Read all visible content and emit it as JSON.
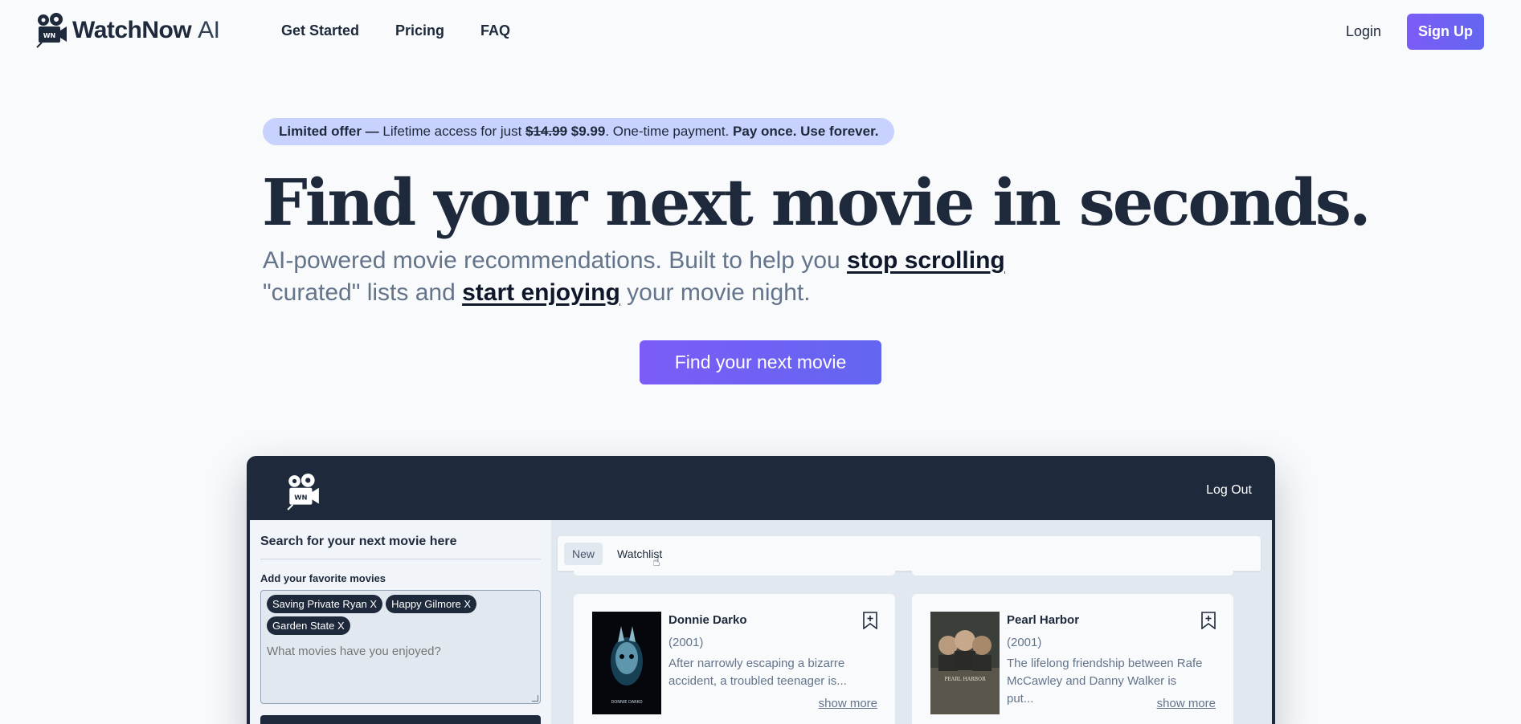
{
  "nav": {
    "brand_name": "WatchNow",
    "brand_suffix": "AI",
    "logo_badge": "WN",
    "links": [
      "Get Started",
      "Pricing",
      "FAQ"
    ],
    "login": "Login",
    "signup": "Sign Up"
  },
  "offer": {
    "lead": "Limited offer",
    "dash": " — ",
    "text": "Lifetime access for just ",
    "old_price": "$14.99",
    "new_price": "$9.99",
    "after": ". One-time payment. ",
    "tail": "Pay once. Use forever."
  },
  "hero": {
    "headline": "Find your next movie in seconds.",
    "sub_1": "AI-powered movie recommendations. Built to help you ",
    "sub_link_1": "stop scrolling",
    "sub_2": "\"curated\" lists and ",
    "sub_link_2": "start enjoying",
    "sub_3": " your movie night.",
    "cta": "Find your next movie"
  },
  "app": {
    "logo_badge": "WN",
    "logout": "Log Out",
    "search_title": "Search for your next movie here",
    "fav_label": "Add your favorite movies",
    "chips": [
      "Saving Private Ryan X",
      "Happy Gilmore X",
      "Garden State X"
    ],
    "fav_placeholder": "What movies have you enjoyed?",
    "tabs": [
      "New",
      "Watchlist"
    ],
    "movies": [
      {
        "title": "Donnie Darko",
        "year": "(2001)",
        "desc": "After narrowly escaping a bizarre accident, a troubled teenager is...",
        "more": "show more",
        "poster_text": "DONNIE DARKO"
      },
      {
        "title": "Pearl Harbor",
        "year": "(2001)",
        "desc": "The lifelong friendship between Rafe McCawley and Danny Walker is put...",
        "more": "show more",
        "poster_text": "PEARL HARBOR"
      }
    ]
  },
  "colors": {
    "accent": "#6366f1",
    "accent_start": "#7c5cf6",
    "dark": "#1e293b",
    "offer_bg": "#c7d2fe",
    "page_bg": "#f8fafc"
  }
}
